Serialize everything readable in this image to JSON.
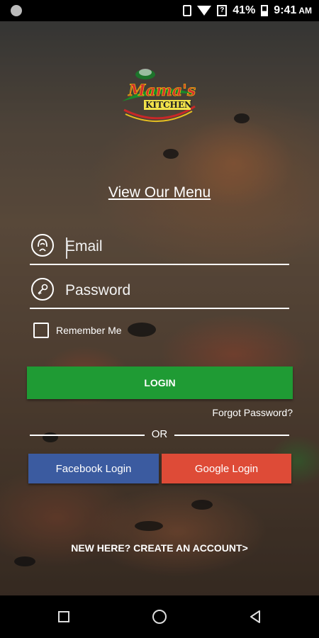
{
  "status_bar": {
    "battery": "41%",
    "time": "9:41",
    "ampm": "AM"
  },
  "logo": {
    "brand_script": "Mama's",
    "brand_block": "KITCHEN"
  },
  "menu_link": "View Our Menu",
  "login_form": {
    "email_placeholder": "Email",
    "password_placeholder": "Password",
    "remember_label": "Remember Me",
    "login_label": "LOGIN",
    "forgot_label": "Forgot Password?"
  },
  "divider_text": "OR",
  "social": {
    "facebook_label": "Facebook Login",
    "google_label": "Google Login"
  },
  "create_account": "NEW HERE? CREATE AN ACCOUNT>",
  "colors": {
    "login": "#1f9b34",
    "facebook": "#3b5ba0",
    "google": "#de4b37"
  },
  "icons": {
    "user": "user-icon",
    "key": "key-icon"
  }
}
